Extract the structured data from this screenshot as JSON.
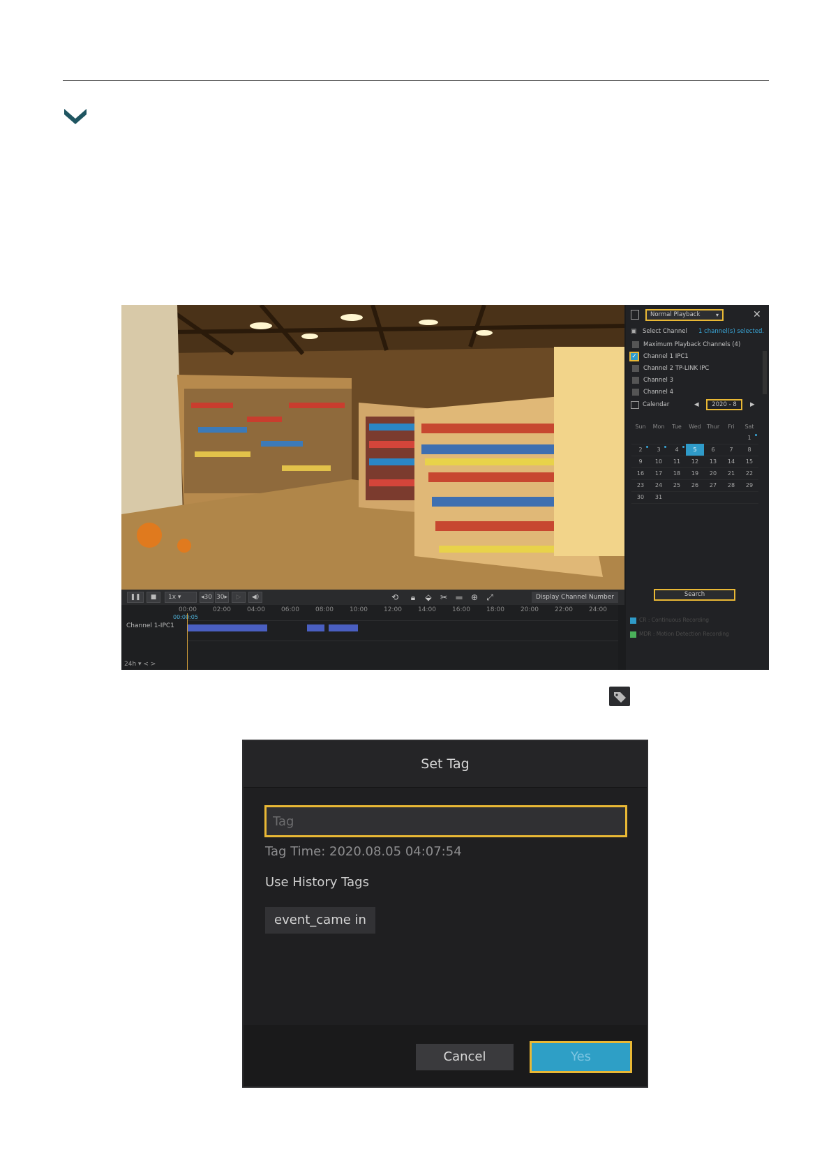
{
  "playback": {
    "mode": "Normal Playback",
    "select_channel_label": "Select Channel",
    "channels_selected": "1 channel(s) selected.",
    "max_channels": "Maximum Playback Channels (4)",
    "channels": [
      "Channel 1 IPC1",
      "Channel 2 TP-LINK IPC",
      "Channel 3",
      "Channel 4"
    ],
    "calendar_label": "Calendar",
    "month": "2020 - 8",
    "weekdays": [
      "Sun",
      "Mon",
      "Tue",
      "Wed",
      "Thur",
      "Fri",
      "Sat"
    ],
    "days": [
      [
        "",
        "",
        "",
        "",
        "",
        "",
        "1"
      ],
      [
        "2",
        "3",
        "4",
        "5",
        "6",
        "7",
        "8"
      ],
      [
        "9",
        "10",
        "11",
        "12",
        "13",
        "14",
        "15"
      ],
      [
        "16",
        "17",
        "18",
        "19",
        "20",
        "21",
        "22"
      ],
      [
        "23",
        "24",
        "25",
        "26",
        "27",
        "28",
        "29"
      ],
      [
        "30",
        "31",
        "",
        "",
        "",
        "",
        ""
      ]
    ],
    "selected_day": "5",
    "search_label": "Search",
    "speed": "1x",
    "skip_back": "30",
    "skip_fwd": "30",
    "display_channel_number": "Display Channel Number",
    "timeline_ticks": [
      "00:00",
      "02:00",
      "04:00",
      "06:00",
      "08:00",
      "10:00",
      "12:00",
      "14:00",
      "16:00",
      "18:00",
      "20:00",
      "22:00",
      "24:00"
    ],
    "current_time": "00:00:05",
    "timeline_channel": "Channel 1-IPC1",
    "zoom": "24h",
    "legend": [
      "CR : Continuous Recording",
      "MDR : Motion Detection Recording"
    ],
    "colors": {
      "accent": "#e9b835",
      "blue": "#2f9bc9",
      "segment": "#4a5fc1"
    }
  },
  "dialog": {
    "title": "Set Tag",
    "tag_placeholder": "Tag",
    "tag_time": "Tag Time: 2020.08.05 04:07:54",
    "history_label": "Use History Tags",
    "history_tag": "event_came in",
    "cancel_label": "Cancel",
    "yes_label": "Yes"
  }
}
